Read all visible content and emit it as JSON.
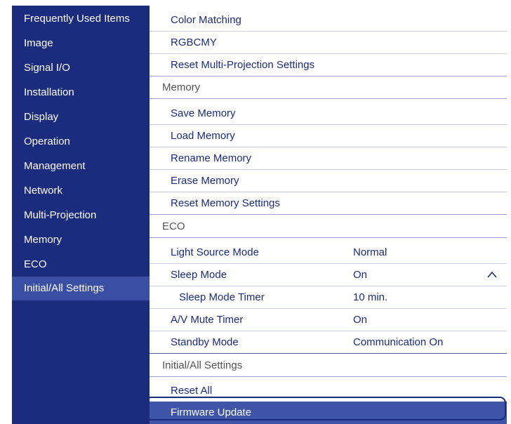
{
  "sidebar": {
    "items": [
      {
        "label": "Frequently Used Items"
      },
      {
        "label": "Image"
      },
      {
        "label": "Signal I/O"
      },
      {
        "label": "Installation"
      },
      {
        "label": "Display"
      },
      {
        "label": "Operation"
      },
      {
        "label": "Management"
      },
      {
        "label": "Network"
      },
      {
        "label": "Multi-Projection"
      },
      {
        "label": "Memory"
      },
      {
        "label": "ECO"
      },
      {
        "label": "Initial/All Settings"
      }
    ],
    "selected": "Initial/All Settings"
  },
  "content": {
    "multi_projection": {
      "color_matching": "Color Matching",
      "rgbcmy": "RGBCMY",
      "reset_multi_projection": "Reset Multi-Projection Settings"
    },
    "memory": {
      "header": "Memory",
      "save_memory": "Save Memory",
      "load_memory": "Load Memory",
      "rename_memory": "Rename Memory",
      "erase_memory": "Erase Memory",
      "reset_memory_settings": "Reset Memory Settings"
    },
    "eco": {
      "header": "ECO",
      "light_source_mode": {
        "label": "Light Source Mode",
        "value": "Normal"
      },
      "sleep_mode": {
        "label": "Sleep Mode",
        "value": "On",
        "icon": "chevron-up-icon"
      },
      "sleep_mode_timer": {
        "label": "Sleep Mode Timer",
        "value": "10 min."
      },
      "av_mute_timer": {
        "label": "A/V Mute Timer",
        "value": "On"
      },
      "standby_mode": {
        "label": "Standby Mode",
        "value": "Communication On"
      }
    },
    "initial_all_settings": {
      "header": "Initial/All Settings",
      "reset_all": "Reset All",
      "firmware_update": "Firmware Update"
    }
  },
  "colors": {
    "sidebar_bg": "#1b2b7d",
    "sidebar_selected": "#3a4ea3",
    "text_accent": "#1b2b7d",
    "highlight": "#3f55a8"
  }
}
